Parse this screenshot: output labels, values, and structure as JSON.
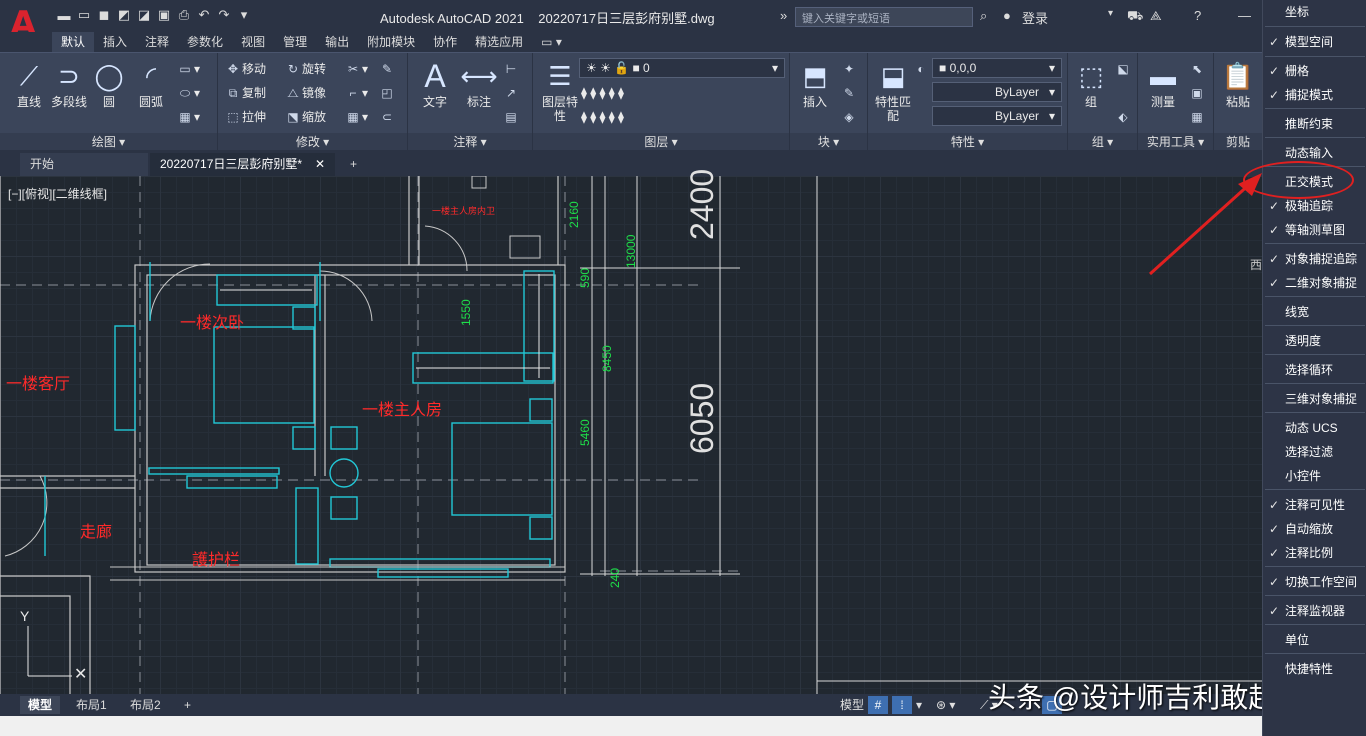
{
  "app": {
    "logo": "A",
    "title": "Autodesk AutoCAD 2021    20220717日三层彭府别墅.dwg",
    "search_placeholder": "键入关键字或短语",
    "login": "登录"
  },
  "ribbon_tabs": [
    "默认",
    "插入",
    "注释",
    "参数化",
    "视图",
    "管理",
    "输出",
    "附加模块",
    "协作",
    "精选应用"
  ],
  "ribbon": {
    "draw": {
      "title": "绘图",
      "line": "直线",
      "polyline": "多段线",
      "circle": "圆",
      "arc": "圆弧"
    },
    "modify": {
      "title": "修改",
      "move": "移动",
      "rotate": "旋转",
      "copy": "复制",
      "mirror": "镜像",
      "stretch": "拉伸",
      "scale": "缩放"
    },
    "annotation": {
      "title": "注释",
      "text": "文字",
      "dimension": "标注"
    },
    "layers": {
      "title": "图层",
      "layer_props": "图层特性",
      "current_layer": "0"
    },
    "block": {
      "title": "块",
      "insert": "插入"
    },
    "properties": {
      "title": "特性",
      "match": "特性匹配",
      "color": "0,0,0",
      "linetype": "ByLayer",
      "lineweight": "ByLayer"
    },
    "groups": {
      "title": "组",
      "group": "组"
    },
    "utilities": {
      "title": "实用工具",
      "measure": "测量"
    },
    "clipboard": {
      "title": "剪贴",
      "paste": "粘贴"
    }
  },
  "doc_tabs": {
    "start": "开始",
    "file": "20220717日三层彭府别墅*"
  },
  "drawing": {
    "view_label": "[−][俯视][二维线框]",
    "rooms": {
      "living": "一楼客厅",
      "second_bedroom": "一楼次卧",
      "master_bedroom": "一楼主人房",
      "master_bath": "一楼主人房内卫",
      "corridor": "走廊",
      "railing": "護护栏"
    },
    "dims": {
      "d2160": "2160",
      "d590": "590",
      "d13000": "13000",
      "d1550": "1550",
      "d8450": "8450",
      "d5460": "5460",
      "d240": "240",
      "d2400": "2400",
      "d6050": "6050"
    },
    "compass_partial": "西"
  },
  "layout_tabs": [
    "模型",
    "布局1",
    "布局2"
  ],
  "status": {
    "model": "模型"
  },
  "watermark": "头条 @设计师吉利敢超",
  "context_menu": {
    "items": [
      {
        "label": "坐标",
        "checked": false
      },
      {
        "label": "模型空间",
        "checked": true
      },
      {
        "label": "栅格",
        "checked": true
      },
      {
        "label": "捕捉模式",
        "checked": true
      },
      {
        "label": "推断约束",
        "checked": false
      },
      {
        "label": "动态输入",
        "checked": false
      },
      {
        "label": "正交模式",
        "checked": false
      },
      {
        "label": "极轴追踪",
        "checked": true
      },
      {
        "label": "等轴测草图",
        "checked": true
      },
      {
        "label": "对象捕捉追踪",
        "checked": true
      },
      {
        "label": "二维对象捕捉",
        "checked": true
      },
      {
        "label": "线宽",
        "checked": false
      },
      {
        "label": "透明度",
        "checked": false
      },
      {
        "label": "选择循环",
        "checked": false
      },
      {
        "label": "三维对象捕捉",
        "checked": false
      },
      {
        "label": "动态 UCS",
        "checked": false
      },
      {
        "label": "选择过滤",
        "checked": false
      },
      {
        "label": "小控件",
        "checked": false
      },
      {
        "label": "注释可见性",
        "checked": true
      },
      {
        "label": "自动缩放",
        "checked": true
      },
      {
        "label": "注释比例",
        "checked": true
      },
      {
        "label": "切换工作空间",
        "checked": true
      },
      {
        "label": "注释监视器",
        "checked": true
      },
      {
        "label": "单位",
        "checked": false
      },
      {
        "label": "快捷特性",
        "checked": false
      }
    ]
  },
  "colors": {
    "accent_red": "#e02020",
    "wall_cyan": "#22c7d6",
    "dim_green": "#1ee04a",
    "room_text_red": "#ff2a2a"
  }
}
